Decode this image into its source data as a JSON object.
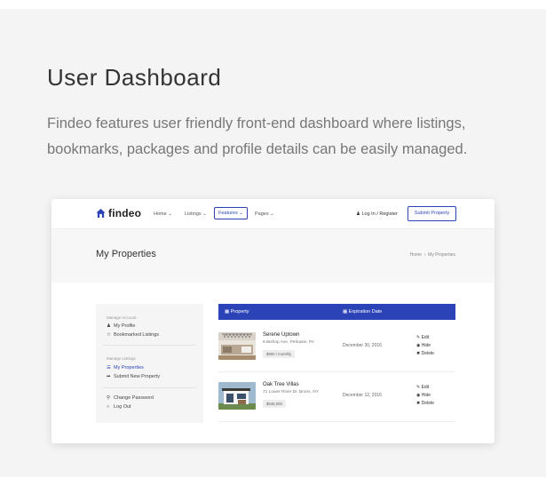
{
  "hero": {
    "title": "User Dashboard",
    "description": "Findeo features user friendly front-end dashboard where listings, bookmarks, packages and profile details can be easily managed."
  },
  "app": {
    "logo": "findeo",
    "nav": [
      "Home",
      "Listings",
      "Features",
      "Pages"
    ],
    "active_nav": "Features",
    "login": "Log In / Register",
    "submit": "Submit Property",
    "page_title": "My Properties",
    "breadcrumb": [
      "Home",
      "My Properties"
    ]
  },
  "sidebar": {
    "manage_account_heading": "Manage Account",
    "my_profile": "My Profile",
    "bookmarked": "Bookmarked Listings",
    "manage_listings_heading": "Manage Listings",
    "my_properties": "My Properties",
    "submit_new": "Submit New Property",
    "change_password": "Change Password",
    "log_out": "Log Out"
  },
  "table": {
    "col_property": "Property",
    "col_expiration": "Expiration Date",
    "rows": [
      {
        "title": "Serene Uptown",
        "address": "6 Bishop Ave. Perkasie, PA",
        "price": "$900 / monthly",
        "date": "December 30, 2016"
      },
      {
        "title": "Oak Tree Villas",
        "address": "71 Lower River Dr. Bronx, NY",
        "price": "$535,000",
        "date": "December 12, 2016"
      }
    ],
    "actions": {
      "edit": "Edit",
      "hide": "Hide",
      "delete": "Delete"
    }
  },
  "colors": {
    "accent": "#2c43b8",
    "background": "#f4f4f4"
  },
  "icons": [
    "home-logo-icon",
    "user-icon",
    "document-icon",
    "calendar-icon",
    "star-icon",
    "pencil-icon",
    "eye-icon",
    "x-icon",
    "lock-icon",
    "power-icon",
    "share-icon",
    "list-icon"
  ]
}
